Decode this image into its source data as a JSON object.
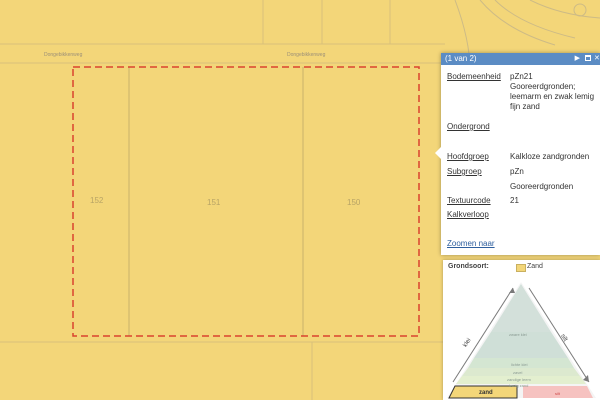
{
  "map": {
    "roads": [
      "Dongebikkenweg",
      "Dongebikkenweg"
    ],
    "parcels": [
      "152",
      "151",
      "150"
    ]
  },
  "popup": {
    "counter": "(1 van 2)",
    "next_icon": "play-icon",
    "fields": [
      {
        "label": "Bodemeenheid",
        "value": "pZn21"
      },
      {
        "label": "",
        "value": "Gooreerdgronden; leemarm en zwak lemig fijn zand"
      },
      {
        "label": "Ondergrond",
        "value": ""
      },
      {
        "label": "Hoofdgroep",
        "value": "Kalkloze zandgronden"
      },
      {
        "label": "Subgroep",
        "value": "pZn"
      },
      {
        "label": "",
        "value": "Gooreerdgronden"
      },
      {
        "label": "Textuurcode",
        "value": "21"
      },
      {
        "label": "Kalkverloop",
        "value": ""
      }
    ],
    "zoom_link": "Zoomen naar"
  },
  "legend": {
    "title": "Grondsoort:",
    "class": "Zand",
    "left_axis": "klei",
    "right_axis": "silt",
    "apex_label": "zware klei",
    "layers": [
      "lichte klei",
      "zavel",
      "zandige leem",
      "lemig zand",
      "zand",
      "silt"
    ],
    "selected": "zand",
    "colors": {
      "zand": "#f3d679",
      "accent": "#d13a2e"
    }
  },
  "colors": {
    "map_fill": "#f3d679",
    "selection": "#d9442f",
    "popup_header": "#5b8cc4"
  }
}
